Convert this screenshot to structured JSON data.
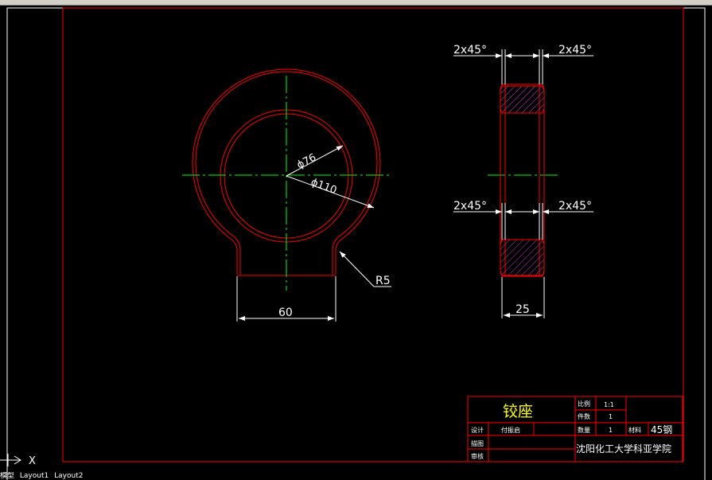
{
  "drawing": {
    "front_view": {
      "inner_diameter_label": "ϕ76",
      "outer_diameter_label": "ϕ110",
      "width_label": "60",
      "radius_label": "R5"
    },
    "side_view": {
      "chamfer_top_left": "2x45°",
      "chamfer_top_right": "2x45°",
      "chamfer_bottom_left": "2x45°",
      "chamfer_bottom_right": "2x45°",
      "thickness_label": "25"
    }
  },
  "title_block": {
    "part_name": "铰座",
    "scale_label": "比例",
    "scale_value": "1:1",
    "count_label": "件数",
    "count_value": "1",
    "quantity_label": "数量",
    "quantity_value": "1",
    "material_label": "材料",
    "material_value": "45钢",
    "design_label": "设计",
    "designer_name": "付振启",
    "draw_label": "描图",
    "review_label": "审核",
    "institution": "沈阳化工大学科亚学院"
  },
  "ucs": {
    "x_label": "X"
  },
  "layout_tabs": [
    "模型",
    "Layout1",
    "Layout2"
  ],
  "colors": {
    "background": "#000000",
    "border": "#ff0000",
    "centerline": "#00ff00",
    "dimension": "#ffffff",
    "hatch": "#cc33cc",
    "title_text": "#ffff00"
  }
}
